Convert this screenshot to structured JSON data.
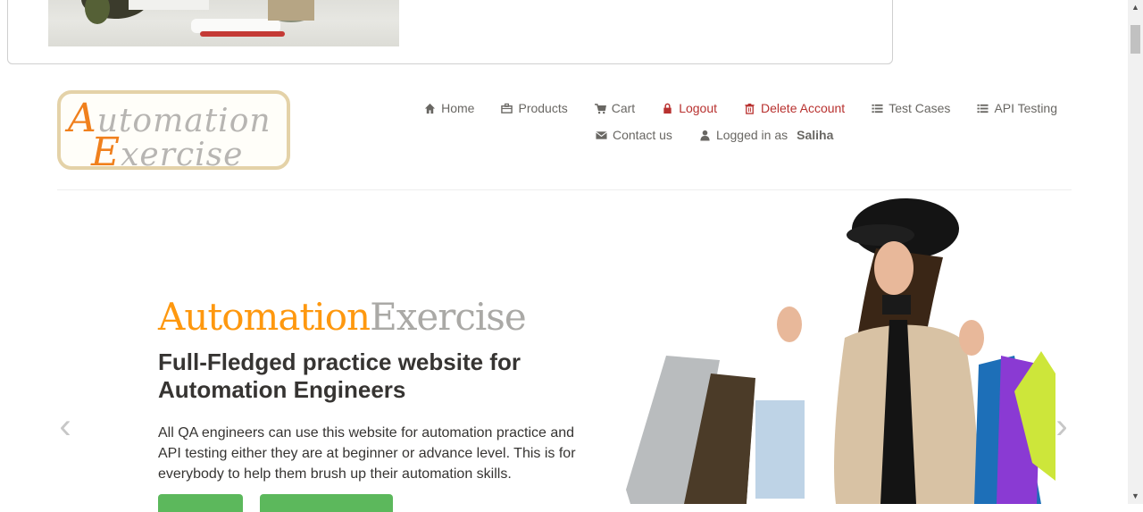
{
  "header": {
    "logo": {
      "line1_cap": "A",
      "line1_rest": "utomation",
      "line2_cap": "E",
      "line2_rest": "xercise"
    },
    "nav": [
      {
        "label": "Home",
        "icon": "home-icon"
      },
      {
        "label": "Products",
        "icon": "briefcase-icon"
      },
      {
        "label": "Cart",
        "icon": "cart-icon"
      },
      {
        "label": "Logout",
        "icon": "lock-icon"
      },
      {
        "label": "Delete Account",
        "icon": "trash-icon"
      },
      {
        "label": "Test Cases",
        "icon": "list-icon"
      },
      {
        "label": "API Testing",
        "icon": "list-icon"
      },
      {
        "label": "Contact us",
        "icon": "envelope-icon"
      }
    ],
    "logged_in_prefix": "Logged in as",
    "logged_in_user": "Saliha"
  },
  "slider": {
    "brand_part1": "Automation",
    "brand_part2": "Exercise",
    "title": "Full-Fledged practice website for Automation Engineers",
    "text": "All QA engineers can use this website for automation practice and API testing either they are at beginner or advance level. This is for everybody to help them brush up their automation skills.",
    "prev_glyph": "‹",
    "next_glyph": "›"
  },
  "colors": {
    "accent_orange": "#fe980f",
    "danger_red": "#b8312f",
    "button_green": "#5cb85c",
    "nav_text": "#696763"
  }
}
